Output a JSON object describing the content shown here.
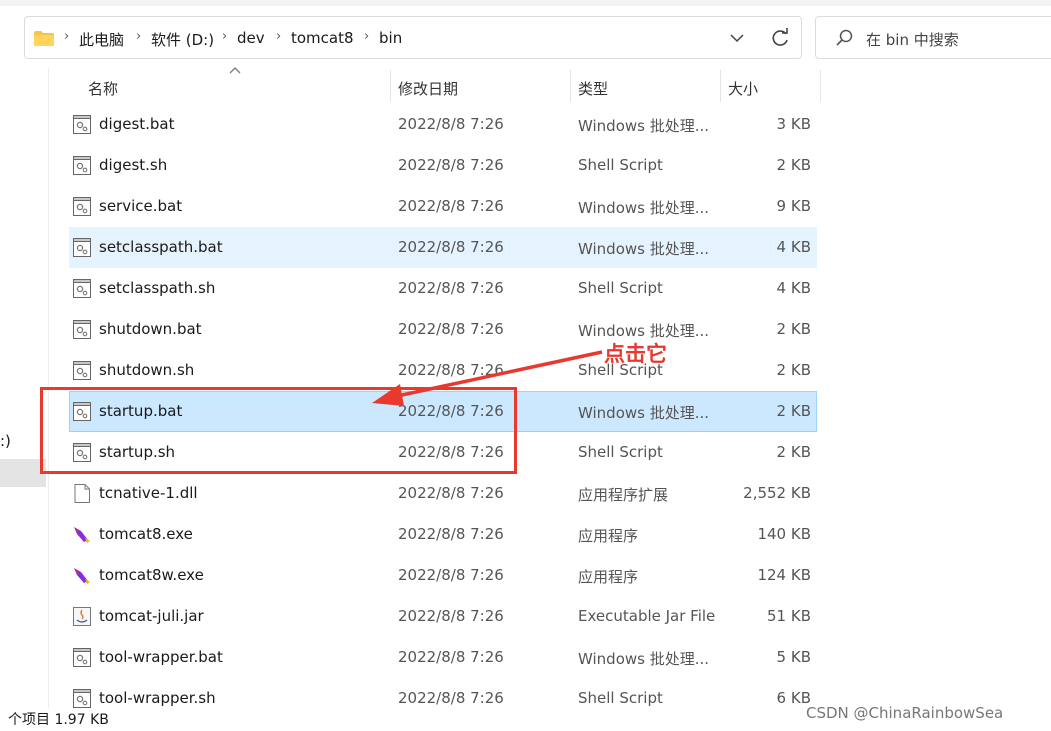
{
  "breadcrumb": [
    "此电脑",
    "软件 (D:)",
    "dev",
    "tomcat8",
    "bin"
  ],
  "search": {
    "placeholder": "在 bin 中搜索"
  },
  "left_pane": {
    "drive_fragment": ":)"
  },
  "columns": {
    "name": "名称",
    "date": "修改日期",
    "type": "类型",
    "size": "大小"
  },
  "files": [
    {
      "name": "digest.bat",
      "date": "2022/8/8 7:26",
      "type": "Windows 批处理...",
      "size": "3 KB",
      "icon": "batch-file-icon"
    },
    {
      "name": "digest.sh",
      "date": "2022/8/8 7:26",
      "type": "Shell Script",
      "size": "2 KB",
      "icon": "script-file-icon"
    },
    {
      "name": "service.bat",
      "date": "2022/8/8 7:26",
      "type": "Windows 批处理...",
      "size": "9 KB",
      "icon": "batch-file-icon"
    },
    {
      "name": "setclasspath.bat",
      "date": "2022/8/8 7:26",
      "type": "Windows 批处理...",
      "size": "4 KB",
      "icon": "batch-file-icon"
    },
    {
      "name": "setclasspath.sh",
      "date": "2022/8/8 7:26",
      "type": "Shell Script",
      "size": "4 KB",
      "icon": "script-file-icon"
    },
    {
      "name": "shutdown.bat",
      "date": "2022/8/8 7:26",
      "type": "Windows 批处理...",
      "size": "2 KB",
      "icon": "batch-file-icon"
    },
    {
      "name": "shutdown.sh",
      "date": "2022/8/8 7:26",
      "type": "Shell Script",
      "size": "2 KB",
      "icon": "script-file-icon"
    },
    {
      "name": "startup.bat",
      "date": "2022/8/8 7:26",
      "type": "Windows 批处理...",
      "size": "2 KB",
      "icon": "batch-file-icon"
    },
    {
      "name": "startup.sh",
      "date": "2022/8/8 7:26",
      "type": "Shell Script",
      "size": "2 KB",
      "icon": "script-file-icon"
    },
    {
      "name": "tcnative-1.dll",
      "date": "2022/8/8 7:26",
      "type": "应用程序扩展",
      "size": "2,552 KB",
      "icon": "dll-file-icon"
    },
    {
      "name": "tomcat8.exe",
      "date": "2022/8/8 7:26",
      "type": "应用程序",
      "size": "140 KB",
      "icon": "tomcat-exe-icon"
    },
    {
      "name": "tomcat8w.exe",
      "date": "2022/8/8 7:26",
      "type": "应用程序",
      "size": "124 KB",
      "icon": "tomcat-exe-icon"
    },
    {
      "name": "tomcat-juli.jar",
      "date": "2022/8/8 7:26",
      "type": "Executable Jar File",
      "size": "51 KB",
      "icon": "jar-file-icon"
    },
    {
      "name": "tool-wrapper.bat",
      "date": "2022/8/8 7:26",
      "type": "Windows 批处理...",
      "size": "5 KB",
      "icon": "batch-file-icon"
    },
    {
      "name": "tool-wrapper.sh",
      "date": "2022/8/8 7:26",
      "type": "Shell Script",
      "size": "6 KB",
      "icon": "script-file-icon"
    }
  ],
  "hover_index": 3,
  "selected_index": 7,
  "annotation": {
    "text": "点击它",
    "color": "#e8392f"
  },
  "status": {
    "text": "个项目  1.97 KB"
  },
  "watermark": "CSDN @ChinaRainbowSea",
  "colors": {
    "selection": "#cce8ff",
    "hover": "#e5f3ff",
    "annotation": "#e8392f"
  }
}
